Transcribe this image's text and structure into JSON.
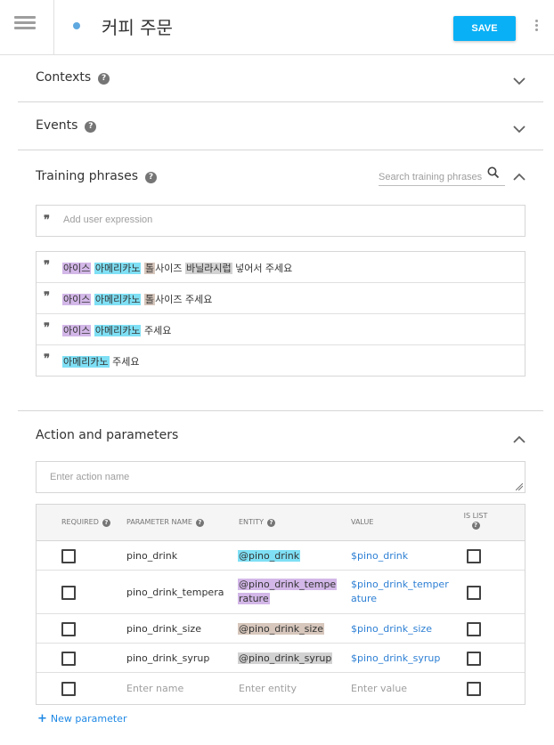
{
  "header": {
    "intent_title": "커피 주문",
    "save_label": "SAVE"
  },
  "sections": {
    "contexts": {
      "title": "Contexts"
    },
    "events": {
      "title": "Events"
    },
    "training": {
      "title": "Training phrases",
      "search_placeholder": "Search training phrases",
      "add_placeholder": "Add user expression",
      "phrases": [
        [
          {
            "text": "아이스",
            "hl": "purple"
          },
          {
            "text": " ",
            "hl": ""
          },
          {
            "text": "아메리카노",
            "hl": "cyan"
          },
          {
            "text": " ",
            "hl": ""
          },
          {
            "text": "톨",
            "hl": "tan"
          },
          {
            "text": "사이즈 ",
            "hl": ""
          },
          {
            "text": "바닐라시럽",
            "hl": "grey"
          },
          {
            "text": " 넣어서 주세요",
            "hl": ""
          }
        ],
        [
          {
            "text": "아이스",
            "hl": "purple"
          },
          {
            "text": " ",
            "hl": ""
          },
          {
            "text": "아메리카노",
            "hl": "cyan"
          },
          {
            "text": " ",
            "hl": ""
          },
          {
            "text": "톨",
            "hl": "tan"
          },
          {
            "text": "사이즈 주세요",
            "hl": ""
          }
        ],
        [
          {
            "text": "아이스",
            "hl": "purple"
          },
          {
            "text": " ",
            "hl": ""
          },
          {
            "text": "아메리카노",
            "hl": "cyan"
          },
          {
            "text": " 주세요",
            "hl": ""
          }
        ],
        [
          {
            "text": "아메리카노",
            "hl": "cyan"
          },
          {
            "text": " 주세요",
            "hl": ""
          }
        ]
      ]
    },
    "action": {
      "title": "Action and parameters",
      "action_placeholder": "Enter action name",
      "columns": [
        "REQUIRED",
        "PARAMETER NAME",
        "ENTITY",
        "VALUE",
        "IS LIST"
      ],
      "rows": [
        {
          "name": "pino_drink",
          "entity": [
            "@pino_drink"
          ],
          "entity_hl": "cyan",
          "value": [
            "$pino_drink"
          ]
        },
        {
          "name": "pino_drink_tempera",
          "entity": [
            "@pino_drink_tempe",
            "rature"
          ],
          "entity_hl": "purple",
          "value": [
            "$pino_drink_temper",
            "ature"
          ]
        },
        {
          "name": "pino_drink_size",
          "entity": [
            "@pino_drink_size"
          ],
          "entity_hl": "tan",
          "value": [
            "$pino_drink_size"
          ]
        },
        {
          "name": "pino_drink_syrup",
          "entity": [
            "@pino_drink_syrup"
          ],
          "entity_hl": "grey",
          "value": [
            "$pino_drink_syrup"
          ]
        }
      ],
      "placeholders": {
        "name": "Enter name",
        "entity": "Enter entity",
        "value": "Enter value"
      },
      "new_param_label": "New parameter"
    }
  },
  "colors": {
    "save": "#0ab0f5",
    "link": "#2d7fd4",
    "hl_purple": "#d3b7e8",
    "hl_cyan": "#7fe0f5",
    "hl_tan": "#d7c7bc",
    "hl_grey": "#d2d2d2"
  }
}
